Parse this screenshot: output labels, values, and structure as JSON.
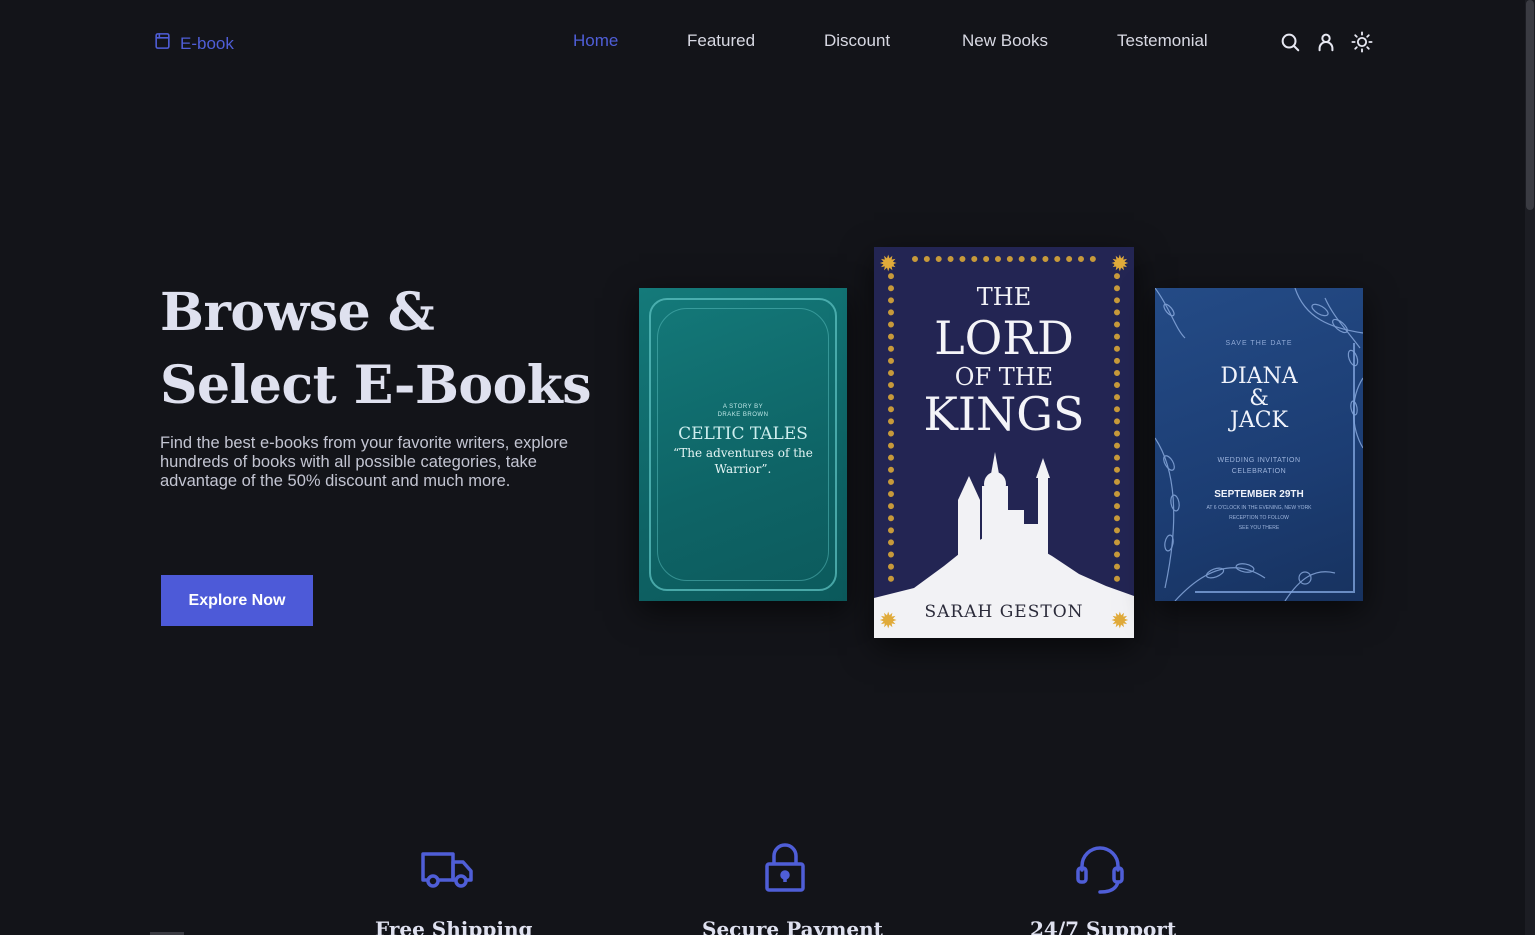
{
  "brand": {
    "name": "E-book",
    "icon": "book-icon",
    "accent": "#4f5ed7"
  },
  "nav": {
    "items": [
      {
        "label": "Home",
        "active": true
      },
      {
        "label": "Featured",
        "active": false
      },
      {
        "label": "Discount",
        "active": false
      },
      {
        "label": "New Books",
        "active": false
      },
      {
        "label": "Testemonial",
        "active": false
      }
    ],
    "icons": [
      "search-icon",
      "user-icon",
      "sun-icon"
    ]
  },
  "hero": {
    "title_line1": "Browse &",
    "title_line2": "Select E-Books",
    "description": "Find the best e-books from your favorite writers, explore hundreds of books with all possible categories, take advantage of the 50% discount and much more.",
    "cta_label": "Explore Now"
  },
  "books": {
    "celtic": {
      "small_line1": "A STORY BY",
      "small_line2": "DRAKE BROWN",
      "title": "CELTIC TALES",
      "subtitle": "“The adventures of the Warrior”."
    },
    "lord": {
      "the": "THE",
      "lord": "LORD",
      "of_the": "OF THE",
      "kings": "KINGS",
      "author": "SARAH GESTON"
    },
    "diana": {
      "save": "SAVE THE DATE",
      "name1": "DIANA",
      "amp": "&",
      "name2": "JACK",
      "invitation": "WEDDING INVITATION",
      "celebration": "CELEBRATION",
      "date": "SEPTEMBER 29TH",
      "details": "AT 6 O'CLOCK IN THE EVENING, NEW YORK",
      "reception": "RECEPTION TO FOLLOW",
      "see_you": "SEE YOU THERE"
    }
  },
  "features": [
    {
      "title": "Free Shipping",
      "icon": "truck-icon"
    },
    {
      "title": "Secure Payment",
      "icon": "lock-icon"
    },
    {
      "title": "24/7 Support",
      "icon": "headset-icon"
    }
  ]
}
